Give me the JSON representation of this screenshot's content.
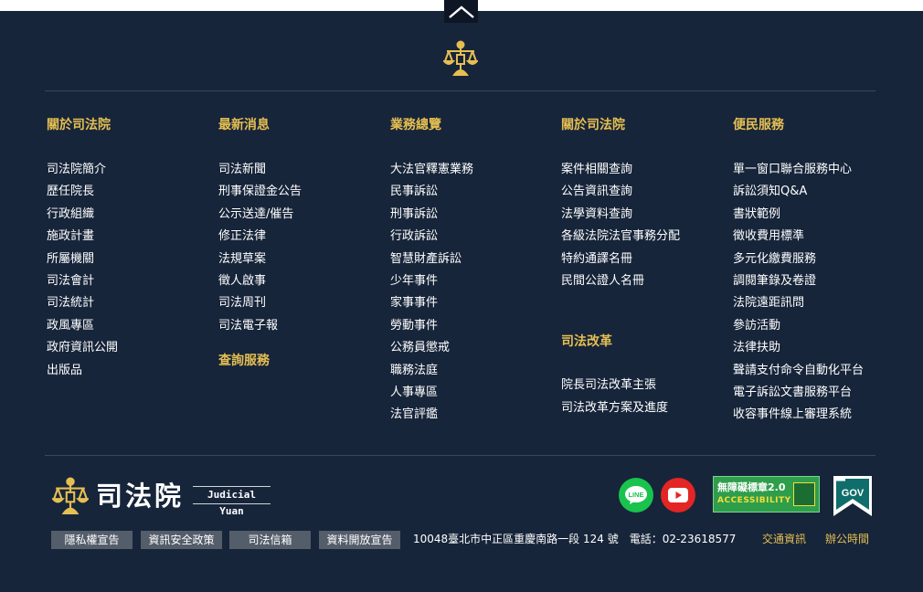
{
  "back_to_top": {
    "icon": "chevron-up-icon"
  },
  "emblem": {
    "icon": "scales-of-justice-icon",
    "color": "#e6bf52"
  },
  "columns": [
    {
      "title": "關於司法院",
      "items": [
        "司法院簡介",
        "歷任院長",
        "行政組織",
        "施政計畫",
        "所屬機關",
        "司法會計",
        "司法統計",
        "政風專區",
        "政府資訊公開",
        "出版品"
      ]
    },
    {
      "title": "最新消息",
      "items": [
        "司法新聞",
        "刑事保證金公告",
        "公示送達/催告",
        "修正法律",
        "法規草案",
        "徵人啟事",
        "司法周刊",
        "司法電子報"
      ],
      "subtitle": "查詢服務"
    },
    {
      "title": "業務總覽",
      "items": [
        "大法官釋憲業務",
        "民事訴訟",
        "刑事訴訟",
        "行政訴訟",
        "智慧財產訴訟",
        "少年事件",
        "家事事件",
        "勞動事件",
        "公務員懲戒",
        "職務法庭",
        "人事專區",
        "法官評鑑"
      ]
    },
    {
      "title": "關於司法院",
      "items": [
        "案件相關查詢",
        "公告資訊查詢",
        "法學資料查詢",
        "各級法院法官事務分配",
        "特約通譯名冊",
        "民間公證人名冊"
      ],
      "subtitle": "司法改革",
      "sub_items": [
        "院長司法改革主張",
        "司法改革方案及進度"
      ]
    },
    {
      "title": "便民服務",
      "items": [
        "單一窗口聯合服務中心",
        "訴訟須知Q&A",
        "書狀範例",
        "徵收費用標準",
        "多元化繳費服務",
        "調閱筆錄及卷證",
        "法院遠距訊問",
        "參訪活動",
        "法律扶助",
        "聲請支付命令自動化平台",
        "電子訴訟文書服務平台",
        "收容事件線上審理系統"
      ]
    }
  ],
  "logo": {
    "zh": "司法院",
    "en": "Judicial Yuan"
  },
  "social": [
    {
      "name": "LINE",
      "icon": "line-icon",
      "color": "#19c34e"
    },
    {
      "name": "YouTube",
      "icon": "youtube-icon",
      "color": "#e32525"
    }
  ],
  "accessibility_badge": {
    "line1": "無障礙標章2.0",
    "line2": "ACCESSIBILITY"
  },
  "gov_badge": {
    "label": "GOV"
  },
  "footer_buttons": [
    "隱私權宣告",
    "資訊安全政策",
    "司法信箱",
    "資料開放宣告"
  ],
  "address": "10048臺北市中正區重慶南路一段 124 號　電話：02-23618577",
  "footer_links": [
    "交通資訊",
    "辦公時間"
  ],
  "colors": {
    "background": "#17253a",
    "accent": "#e6bf52",
    "button_bg": "#545d6a"
  }
}
